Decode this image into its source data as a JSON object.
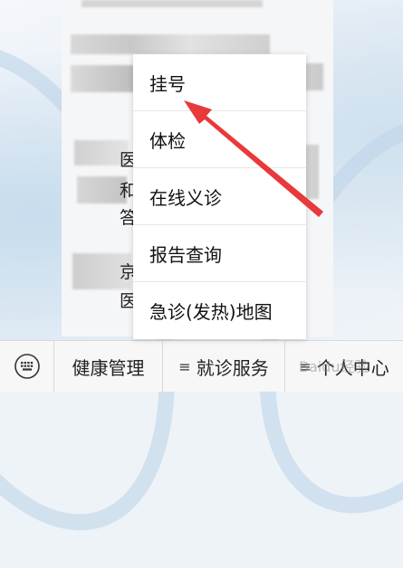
{
  "menu": {
    "items": [
      {
        "label": "挂号"
      },
      {
        "label": "体检"
      },
      {
        "label": "在线义诊"
      },
      {
        "label": "报告查询"
      },
      {
        "label": "急诊(发热)地图"
      }
    ]
  },
  "tabbar": {
    "keyboard_icon": "keyboard-icon",
    "tabs": [
      {
        "label": "健康管理",
        "has_menu_icon": false
      },
      {
        "label": "就诊服务",
        "has_menu_icon": true
      },
      {
        "label": "个人中心",
        "has_menu_icon": true
      }
    ],
    "menu_icon_glyph": "≡"
  },
  "watermark": {
    "text": "Baidu经验"
  },
  "chat_fragments": [
    "医",
    "和",
    "答",
    "京",
    "医"
  ],
  "colors": {
    "arrow": "#e8393b",
    "menu_bg": "#ffffff",
    "tabbar_bg": "#f7f7f7"
  }
}
